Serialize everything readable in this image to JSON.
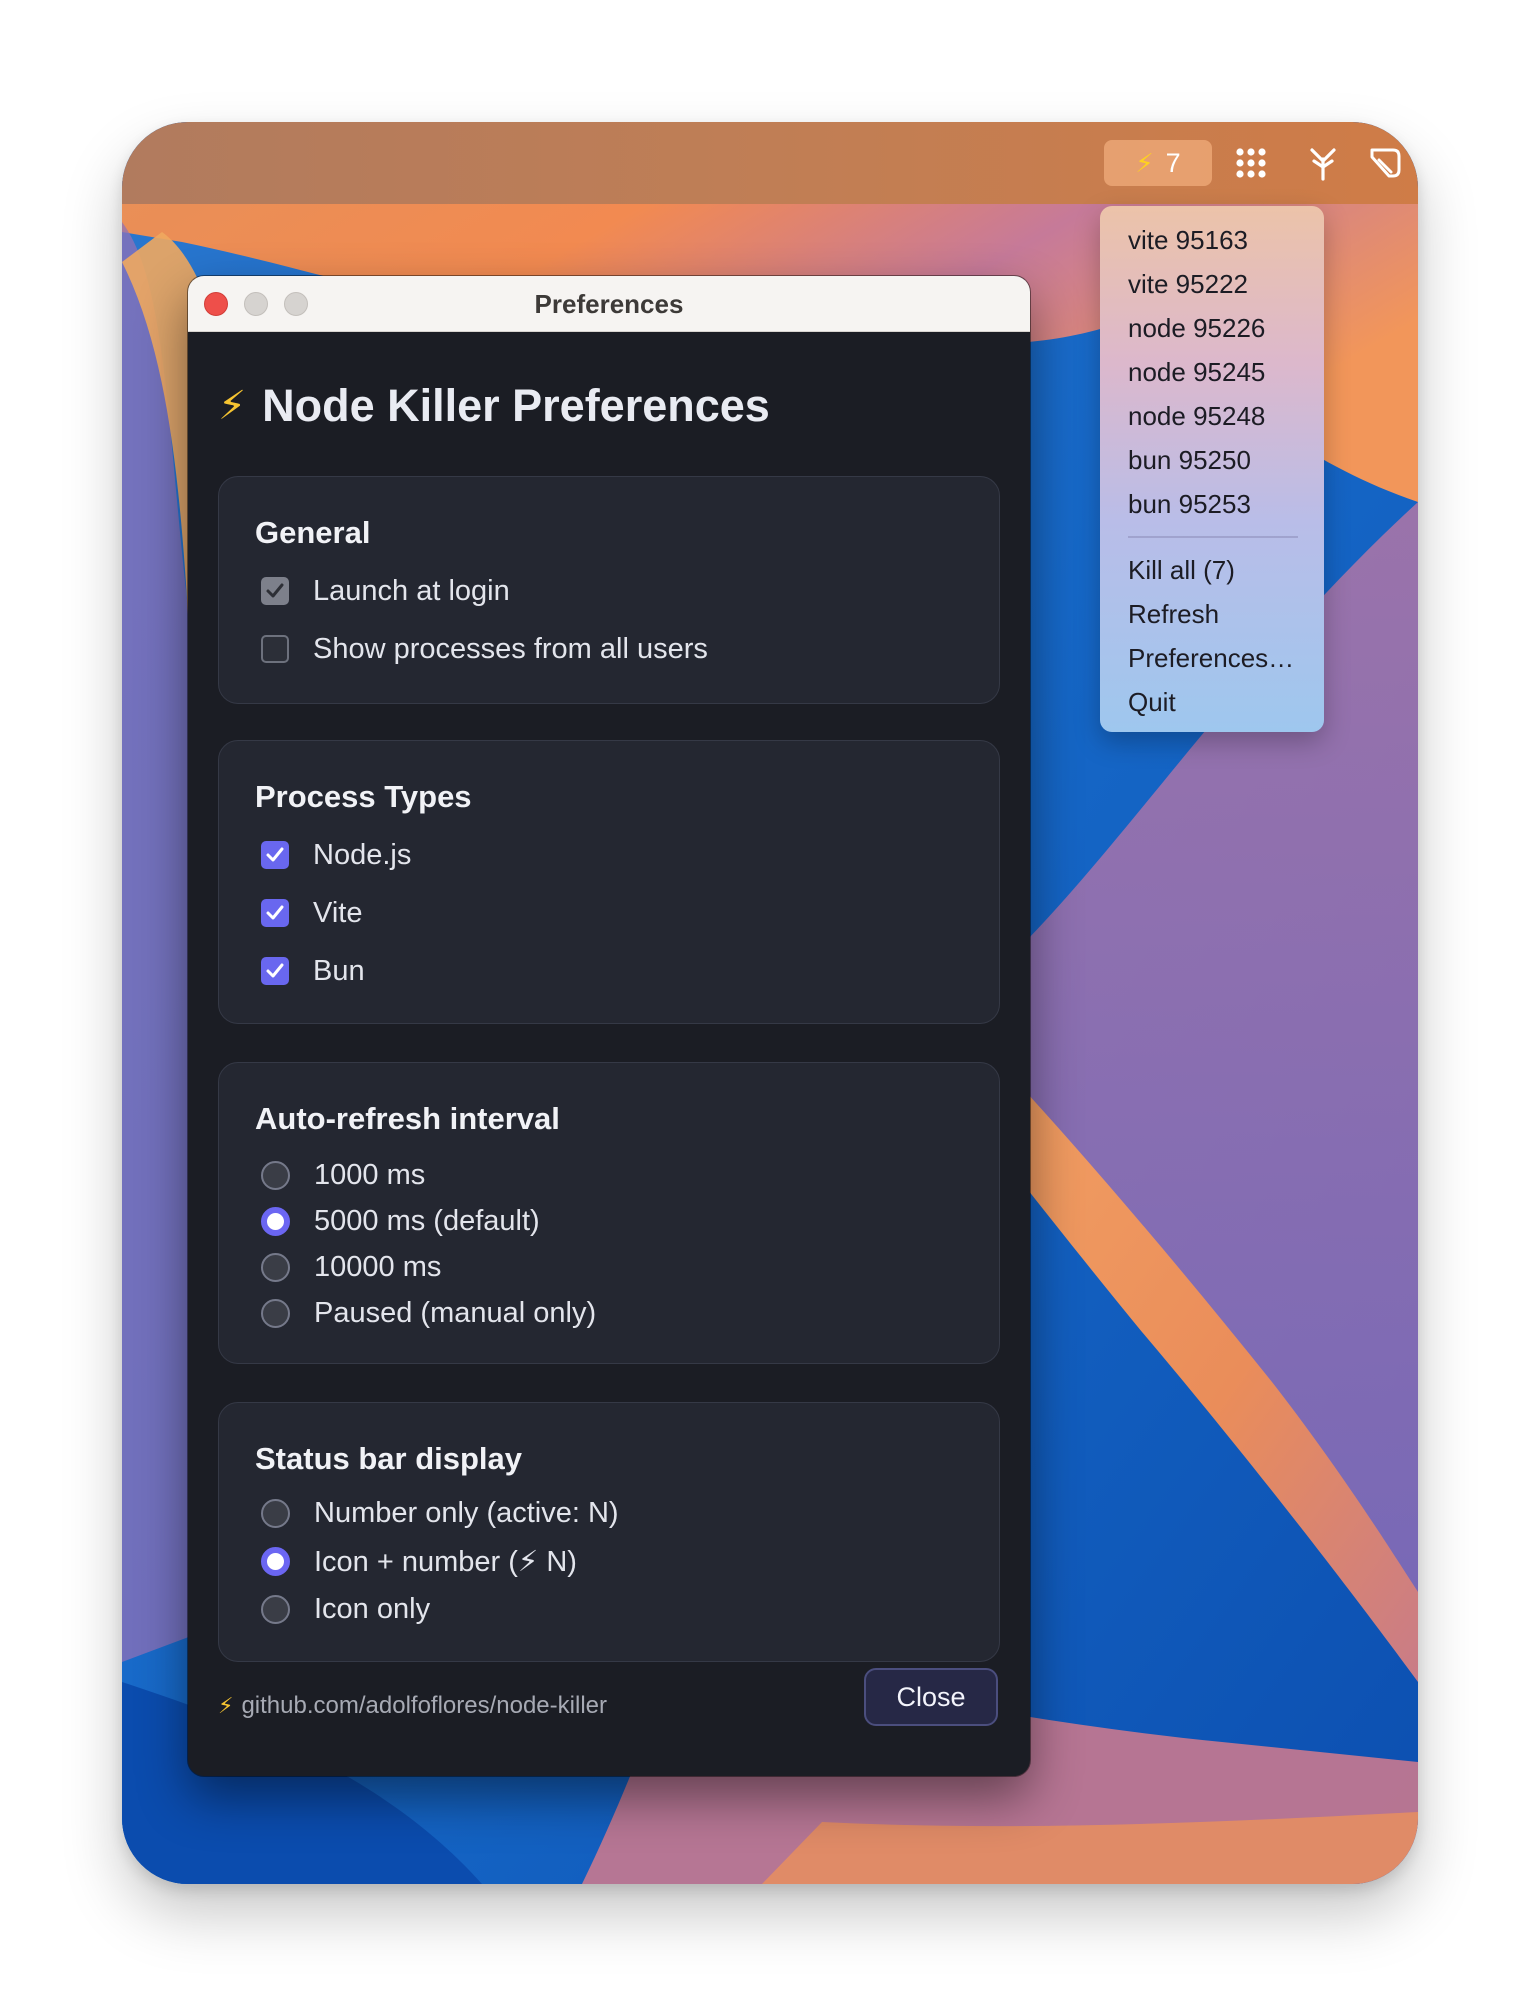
{
  "menubar": {
    "status_bolt": "⚡",
    "status_count": "7",
    "icons": [
      "grid-dots-icon",
      "branch-fork-icon",
      "tag-icon"
    ]
  },
  "menu": {
    "processes": [
      "vite 95163",
      "vite 95222",
      "node 95226",
      "node 95245",
      "node 95248",
      "bun 95250",
      "bun 95253"
    ],
    "actions": [
      "Kill all (7)",
      "Refresh",
      "Preferences…",
      "Quit"
    ]
  },
  "window": {
    "title": "Preferences",
    "heading_icon": "⚡",
    "heading": "Node Killer Preferences"
  },
  "general": {
    "title": "General",
    "options": [
      {
        "label": "Launch at login",
        "checked": true,
        "disabled": true
      },
      {
        "label": "Show processes from all users",
        "checked": false
      }
    ]
  },
  "process_types": {
    "title": "Process Types",
    "options": [
      {
        "label": "Node.js",
        "checked": true
      },
      {
        "label": "Vite",
        "checked": true
      },
      {
        "label": "Bun",
        "checked": true
      }
    ]
  },
  "auto_refresh": {
    "title": "Auto-refresh interval",
    "options": [
      {
        "label": "1000 ms",
        "selected": false
      },
      {
        "label": "5000 ms (default)",
        "selected": true
      },
      {
        "label": "10000 ms",
        "selected": false
      },
      {
        "label": "Paused (manual only)",
        "selected": false
      }
    ]
  },
  "status_bar": {
    "title": "Status bar display",
    "options": [
      {
        "label": "Number only (active: N)",
        "selected": false
      },
      {
        "label": "Icon + number (⚡ N)",
        "selected": true
      },
      {
        "label": "Icon only",
        "selected": false
      }
    ]
  },
  "footer": {
    "link_icon": "⚡",
    "link": "github.com/adolfoflores/node-killer",
    "close_label": "Close"
  },
  "colors": {
    "accent": "#6967ef",
    "window_bg": "#1b1d24",
    "card_bg": "#242731"
  }
}
